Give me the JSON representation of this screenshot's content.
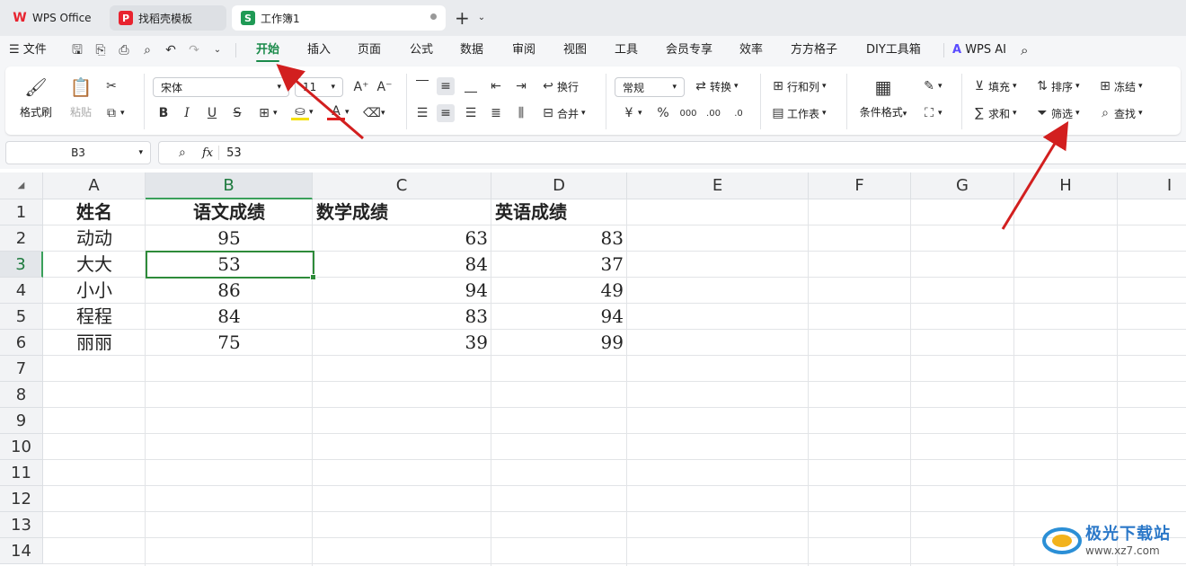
{
  "tabs": [
    {
      "label": "WPS Office",
      "logo": "W",
      "color": "#e8232f"
    },
    {
      "label": "找稻壳模板",
      "logo": "P",
      "color": "#e8232f"
    },
    {
      "label": "工作簿1",
      "logo": "S",
      "color": "#1f9a55"
    }
  ],
  "menu": {
    "file": "文件",
    "items": [
      "开始",
      "插入",
      "页面",
      "公式",
      "数据",
      "审阅",
      "视图",
      "工具",
      "会员专享",
      "效率",
      "方方格子",
      "DIY工具箱"
    ],
    "active": "开始",
    "wps_ai": "WPS AI"
  },
  "ribbon": {
    "format_painter": "格式刷",
    "paste": "粘贴",
    "font_name": "宋体",
    "font_size": "11",
    "wrap": "换行",
    "merge": "合并",
    "number_format": "常规",
    "convert": "转换",
    "row_col": "行和列",
    "worksheet": "工作表",
    "cond_format": "条件格式",
    "fill": "填充",
    "sort": "排序",
    "freeze": "冻结",
    "sum": "求和",
    "filter": "筛选",
    "find": "查找"
  },
  "formula_bar": {
    "cell_ref": "B3",
    "fx": "fx",
    "value": "53"
  },
  "columns": [
    "A",
    "B",
    "C",
    "D",
    "E",
    "F",
    "G",
    "H",
    "I"
  ],
  "rows": [
    "1",
    "2",
    "3",
    "4",
    "5",
    "6",
    "7",
    "8",
    "9",
    "10",
    "11",
    "12",
    "13",
    "14"
  ],
  "table": {
    "headers": [
      "姓名",
      "语文成绩",
      "数学成绩",
      "英语成绩"
    ],
    "rows": [
      [
        "动动",
        "95",
        "63",
        "83"
      ],
      [
        "大大",
        "53",
        "84",
        "37"
      ],
      [
        "小小",
        "86",
        "94",
        "49"
      ],
      [
        "程程",
        "84",
        "83",
        "94"
      ],
      [
        "丽丽",
        "75",
        "39",
        "99"
      ]
    ]
  },
  "watermark": {
    "title": "极光下载站",
    "url": "www.xz7.com"
  },
  "colors": {
    "accent": "#1a8a4a",
    "arrow": "#d21f1f",
    "selection": "#2e8b3a"
  }
}
